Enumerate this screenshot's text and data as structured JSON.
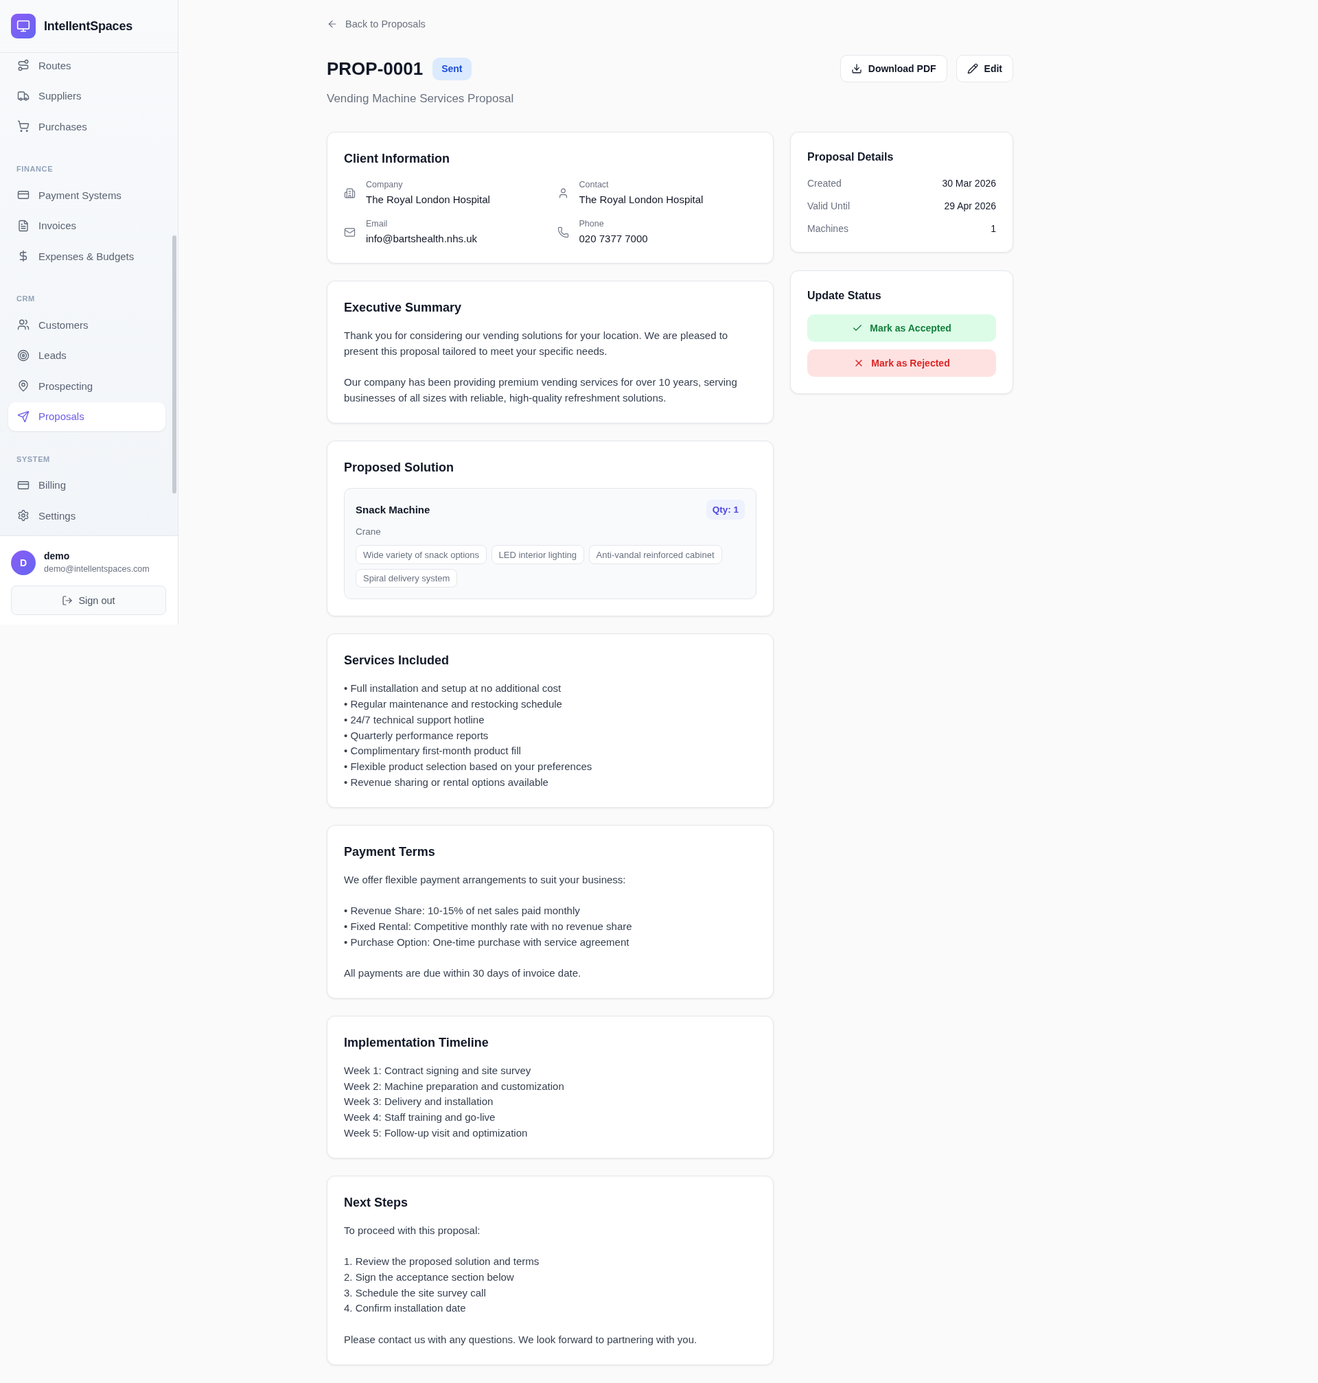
{
  "sidebar": {
    "brand": "IntellentSpaces",
    "sections": [
      {
        "items": [
          {
            "label": "Routes",
            "selected": false
          },
          {
            "label": "Suppliers",
            "selected": false
          },
          {
            "label": "Purchases",
            "selected": false
          }
        ]
      },
      {
        "heading": "FINANCE",
        "items": [
          {
            "label": "Payment Systems",
            "selected": false
          },
          {
            "label": "Invoices",
            "selected": false
          },
          {
            "label": "Expenses & Budgets",
            "selected": false
          }
        ]
      },
      {
        "heading": "CRM",
        "items": [
          {
            "label": "Customers",
            "selected": false
          },
          {
            "label": "Leads",
            "selected": false
          },
          {
            "label": "Prospecting",
            "selected": false
          },
          {
            "label": "Proposals",
            "selected": true
          }
        ]
      },
      {
        "heading": "SYSTEM",
        "items": [
          {
            "label": "Billing",
            "selected": false
          },
          {
            "label": "Settings",
            "selected": false
          }
        ]
      }
    ],
    "user": {
      "initial": "D",
      "name": "demo",
      "email": "demo@intellentspaces.com"
    },
    "sign_out": "Sign out"
  },
  "header": {
    "back_link": "Back to Proposals",
    "title": "PROP-0001",
    "status": "Sent",
    "actions": [
      "Download PDF",
      "Edit"
    ],
    "subtitle": "Vending Machine Services Proposal"
  },
  "main_cards": [
    {
      "kind": "client_info",
      "title": "Client Information",
      "fields": [
        {
          "label": "Company",
          "value": "The Royal London Hospital"
        },
        {
          "label": "Contact",
          "value": "The Royal London Hospital"
        },
        {
          "label": "Email",
          "value": "info@bartshealth.nhs.uk"
        },
        {
          "label": "Phone",
          "value": "020 7377 7000"
        }
      ]
    },
    {
      "kind": "text",
      "title": "Executive Summary",
      "blocks": [
        {
          "kind": "paragraph",
          "text": "Thank you for considering our vending solutions for your location. We are pleased to present this proposal tailored to meet your specific needs."
        },
        {
          "kind": "paragraph",
          "text": "Our company has been providing premium vending services for over 10 years, serving businesses of all sizes with reliable, high-quality refreshment solutions."
        }
      ]
    },
    {
      "kind": "solution",
      "title": "Proposed Solution",
      "machines": [
        {
          "name": "Snack Machine",
          "quantity": "Qty: 1",
          "type": "Crane",
          "features": [
            "Wide variety of snack options",
            "LED interior lighting",
            "Anti-vandal reinforced cabinet",
            "Spiral delivery system"
          ]
        }
      ]
    },
    {
      "kind": "text",
      "title": "Services Included",
      "blocks": [
        {
          "kind": "list",
          "items": [
            "• Full installation and setup at no additional cost",
            "• Regular maintenance and restocking schedule",
            "• 24/7 technical support hotline",
            "• Quarterly performance reports",
            "• Complimentary first-month product fill",
            "• Flexible product selection based on your preferences",
            "• Revenue sharing or rental options available"
          ]
        }
      ]
    },
    {
      "kind": "text",
      "title": "Payment Terms",
      "blocks": [
        {
          "kind": "paragraph",
          "text": "We offer flexible payment arrangements to suit your business:"
        },
        {
          "kind": "list",
          "items": [
            "• Revenue Share: 10-15% of net sales paid monthly",
            "• Fixed Rental: Competitive monthly rate with no revenue share",
            "• Purchase Option: One-time purchase with service agreement"
          ]
        },
        {
          "kind": "paragraph",
          "text": "All payments are due within 30 days of invoice date."
        }
      ]
    },
    {
      "kind": "text",
      "title": "Implementation Timeline",
      "blocks": [
        {
          "kind": "list",
          "items": [
            "Week 1: Contract signing and site survey",
            "Week 2: Machine preparation and customization",
            "Week 3: Delivery and installation",
            "Week 4: Staff training and go-live",
            "Week 5: Follow-up visit and optimization"
          ]
        }
      ]
    },
    {
      "kind": "text",
      "title": "Next Steps",
      "blocks": [
        {
          "kind": "paragraph",
          "text": "To proceed with this proposal:"
        },
        {
          "kind": "list",
          "items": [
            "1. Review the proposed solution and terms",
            "2. Sign the acceptance section below",
            "3. Schedule the site survey call",
            "4. Confirm installation date"
          ]
        },
        {
          "kind": "paragraph",
          "text": "Please contact us with any questions. We look forward to partnering with you."
        }
      ]
    }
  ],
  "proposal_details": {
    "title": "Proposal Details",
    "rows": [
      {
        "label": "Created",
        "value": "30 Mar 2026"
      },
      {
        "label": "Valid Until",
        "value": "29 Apr 2026"
      },
      {
        "label": "Machines",
        "value": "1"
      }
    ]
  },
  "update_status": {
    "title": "Update Status",
    "actions": [
      {
        "kind": "accept",
        "label": "Mark as Accepted"
      },
      {
        "kind": "reject",
        "label": "Mark as Rejected"
      }
    ]
  }
}
